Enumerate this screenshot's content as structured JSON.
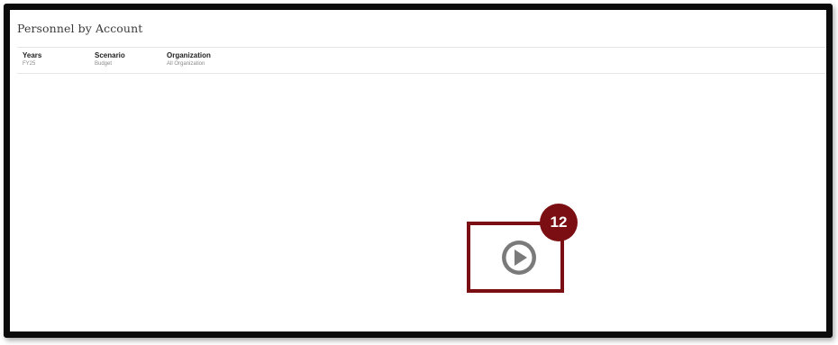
{
  "page": {
    "title": "Personnel by Account"
  },
  "pov": [
    {
      "label": "Years",
      "value": "FY25"
    },
    {
      "label": "Scenario",
      "value": "Budget"
    },
    {
      "label": "Organization",
      "value": "All Organization"
    }
  ],
  "overlay": {
    "step_number": "12",
    "play_icon": "play-circle-icon",
    "accent_color": "#7b0e12",
    "icon_color": "#7a7a7a"
  }
}
